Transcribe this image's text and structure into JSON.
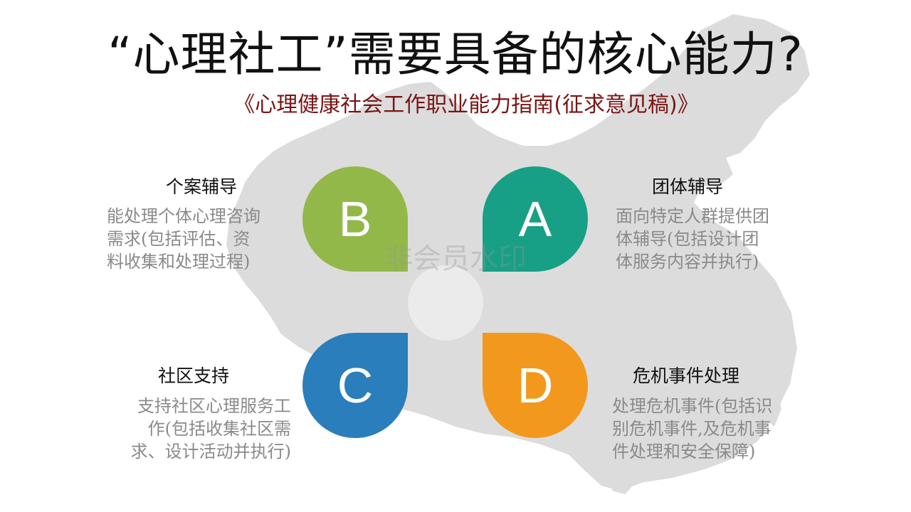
{
  "title": "“心理社工”需要具备的核心能力?",
  "subtitle": "《心理健康社会工作职业能力指南(征求意见稿)》",
  "watermark": "非会员水印",
  "colors": {
    "green": "#93b84a",
    "teal": "#17a085",
    "blue": "#2a7ebb",
    "orange": "#f2991d",
    "map": "#dcdcdc",
    "title": "#111111",
    "subtitle": "#7a1414",
    "description": "#8a8a8a"
  },
  "items": {
    "b": {
      "letter": "B",
      "heading": "个案辅导",
      "lines": [
        "能处理个体心理咨询",
        "需求(包括评估、资",
        "料收集和处理过程)"
      ]
    },
    "a": {
      "letter": "A",
      "heading": "团体辅导",
      "lines": [
        "面向特定人群提供团",
        "体辅导(包括设计团",
        "体服务内容并执行)"
      ]
    },
    "c": {
      "letter": "C",
      "heading": "社区支持",
      "lines": [
        "支持社区心理服务工",
        "作(包括收集社区需",
        "求、设计活动并执行)"
      ]
    },
    "d": {
      "letter": "D",
      "heading": "危机事件处理",
      "lines": [
        "处理危机事件(包括识",
        "别危机事件,及危机事",
        "件处理和安全保障)"
      ]
    }
  }
}
